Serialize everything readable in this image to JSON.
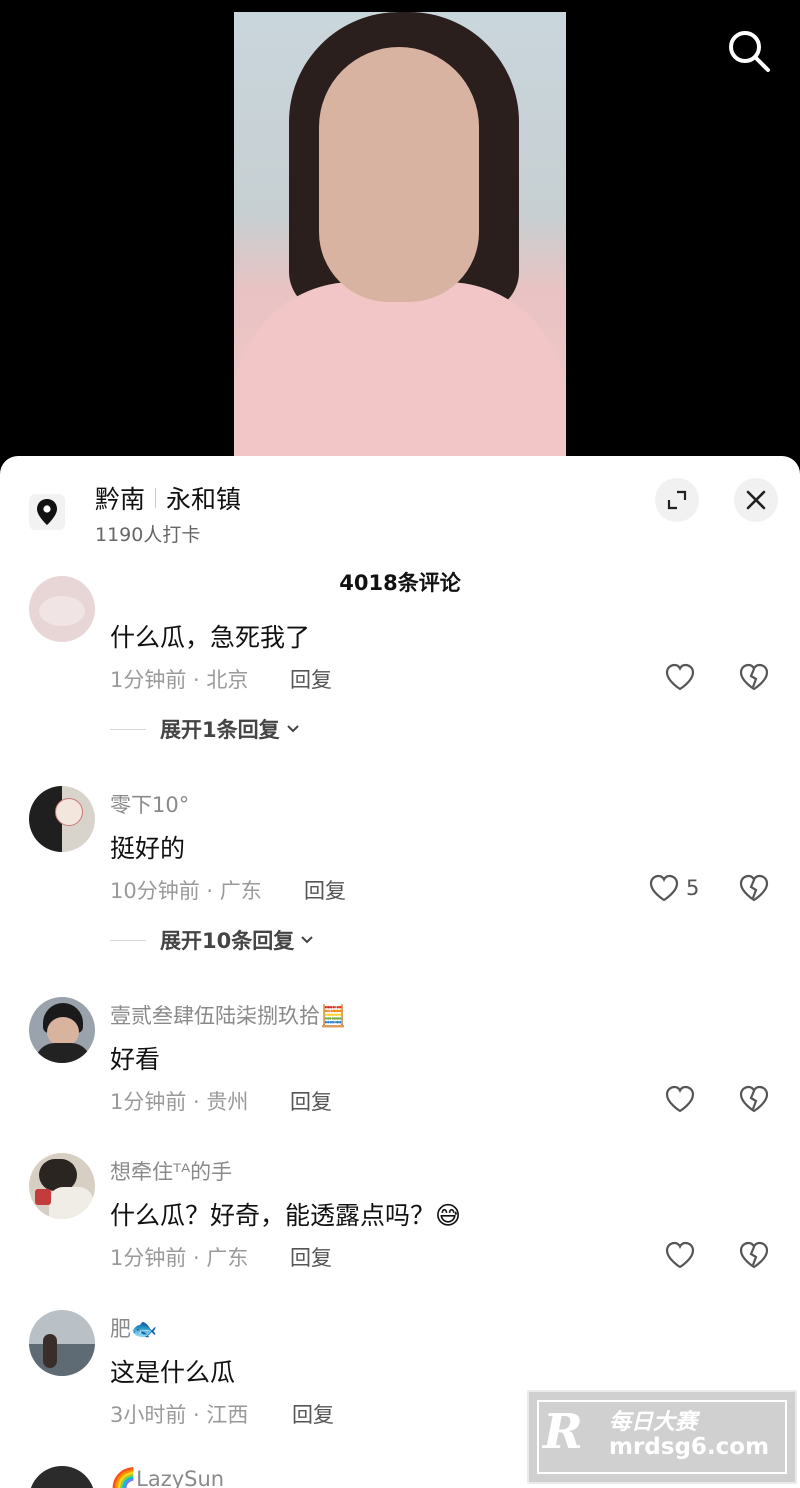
{
  "location": {
    "region": "黔南",
    "place": "永和镇",
    "checkins": "1190人打卡"
  },
  "comments_header": "4018条评论",
  "comments": [
    {
      "username": "",
      "text": "什么瓜，急死我了",
      "time_location": "1分钟前 · 北京",
      "reply_label": "回复",
      "like_count": "",
      "expand_label": "展开1条回复"
    },
    {
      "username": "零下10°",
      "text": "挺好的",
      "time_location": "10分钟前 · 广东",
      "reply_label": "回复",
      "like_count": "5",
      "expand_label": "展开10条回复"
    },
    {
      "username": "壹贰叁肆伍陆柒捌玖拾🧮",
      "text": "好看",
      "time_location": "1分钟前 · 贵州",
      "reply_label": "回复",
      "like_count": ""
    },
    {
      "username": "想牵住ᵀᴬ的手",
      "text": "什么瓜？好奇，能透露点吗？😅",
      "time_location": "1分钟前 · 广东",
      "reply_label": "回复",
      "like_count": ""
    },
    {
      "username": "肥🐟",
      "text": "这是什么瓜",
      "time_location": "3小时前 · 江西",
      "reply_label": "回复",
      "like_count": ""
    },
    {
      "username": "🌈LazySun"
    }
  ],
  "watermark": {
    "name": "每日大赛",
    "url": "mrdsg6.com"
  }
}
